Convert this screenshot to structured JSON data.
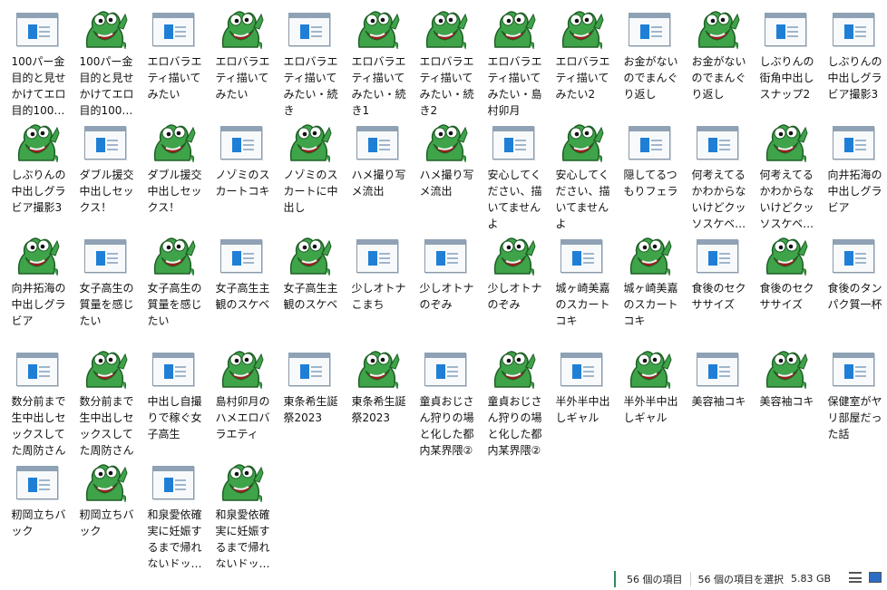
{
  "items": [
    {
      "name": "100パー金目的と見せかけてエロ目的100…",
      "icon": "window-icon"
    },
    {
      "name": "100パー金目的と見せかけてエロ目的100…",
      "icon": "frog-icon"
    },
    {
      "name": "エロバラエティ描いてみたい",
      "icon": "window-icon"
    },
    {
      "name": "エロバラエティ描いてみたい",
      "icon": "frog-icon"
    },
    {
      "name": "エロバラエティ描いてみたい・続き",
      "icon": "window-icon"
    },
    {
      "name": "エロバラエティ描いてみたい・続き1",
      "icon": "frog-icon"
    },
    {
      "name": "エロバラエティ描いてみたい・続き2",
      "icon": "frog-icon"
    },
    {
      "name": "エロバラエティ描いてみたい・島村卯月",
      "icon": "frog-icon"
    },
    {
      "name": "エロバラエティ描いてみたい2",
      "icon": "frog-icon"
    },
    {
      "name": "お金がないのでまんぐり返し",
      "icon": "window-icon"
    },
    {
      "name": "お金がないのでまんぐり返し",
      "icon": "frog-icon"
    },
    {
      "name": "しぶりんの街角中出しスナップ2",
      "icon": "window-icon"
    },
    {
      "name": "しぶりんの中出しグラビア撮影3",
      "icon": "window-icon"
    },
    {
      "name": "しぶりんの中出しグラビア撮影3",
      "icon": "frog-icon"
    },
    {
      "name": "ダブル援交中出しセックス！",
      "icon": "window-icon"
    },
    {
      "name": "ダブル援交中出しセックス！",
      "icon": "frog-icon"
    },
    {
      "name": "ノゾミのスカートコキ",
      "icon": "window-icon"
    },
    {
      "name": "ノゾミのスカートに中出し",
      "icon": "frog-icon"
    },
    {
      "name": "ハメ撮り写メ流出",
      "icon": "window-icon"
    },
    {
      "name": "ハメ撮り写メ流出",
      "icon": "frog-icon"
    },
    {
      "name": "安心してください、描いてませんよ",
      "icon": "window-icon"
    },
    {
      "name": "安心してください、描いてませんよ",
      "icon": "frog-icon"
    },
    {
      "name": "隠してるつもりフェラ",
      "icon": "window-icon"
    },
    {
      "name": "何考えてるかわからないけどクッソスケベ…",
      "icon": "window-icon"
    },
    {
      "name": "何考えてるかわからないけどクッソスケベ…",
      "icon": "frog-icon"
    },
    {
      "name": "向井拓海の中出しグラビア",
      "icon": "window-icon"
    },
    {
      "name": "向井拓海の中出しグラビア",
      "icon": "frog-icon"
    },
    {
      "name": "女子高生の質量を感じたい",
      "icon": "window-icon"
    },
    {
      "name": "女子高生の質量を感じたい",
      "icon": "frog-icon"
    },
    {
      "name": "女子高生主観のスケベ",
      "icon": "window-icon"
    },
    {
      "name": "女子高生主観のスケベ",
      "icon": "frog-icon"
    },
    {
      "name": "少しオトナこまち",
      "icon": "window-icon"
    },
    {
      "name": "少しオトナのぞみ",
      "icon": "window-icon"
    },
    {
      "name": "少しオトナのぞみ",
      "icon": "frog-icon"
    },
    {
      "name": "城ヶ崎美嘉のスカートコキ",
      "icon": "window-icon"
    },
    {
      "name": "城ヶ崎美嘉のスカートコキ",
      "icon": "frog-icon"
    },
    {
      "name": "食後のセクササイズ",
      "icon": "window-icon"
    },
    {
      "name": "食後のセクササイズ",
      "icon": "frog-icon"
    },
    {
      "name": "食後のタンパク質一杯",
      "icon": "window-icon"
    },
    {
      "name": "数分前まで生中出しセックスしてた周防さん",
      "icon": "window-icon"
    },
    {
      "name": "数分前まで生中出しセックスしてた周防さん",
      "icon": "frog-icon"
    },
    {
      "name": "中出し自撮りで稼ぐ女子高生",
      "icon": "window-icon"
    },
    {
      "name": "島村卯月のハメエロバラエティ",
      "icon": "frog-icon"
    },
    {
      "name": "東条希生誕祭2023",
      "icon": "window-icon"
    },
    {
      "name": "東条希生誕祭2023",
      "icon": "frog-icon"
    },
    {
      "name": "童貞おじさん狩りの場と化した都内某界隈②",
      "icon": "window-icon"
    },
    {
      "name": "童貞おじさん狩りの場と化した都内某界隈②",
      "icon": "frog-icon"
    },
    {
      "name": "半外半中出しギャル",
      "icon": "window-icon"
    },
    {
      "name": "半外半中出しギャル",
      "icon": "frog-icon"
    },
    {
      "name": "美容袖コキ",
      "icon": "window-icon"
    },
    {
      "name": "美容袖コキ",
      "icon": "frog-icon"
    },
    {
      "name": "保健室がヤリ部屋だった話",
      "icon": "window-icon"
    },
    {
      "name": "籾岡立ちバック",
      "icon": "window-icon"
    },
    {
      "name": "籾岡立ちバック",
      "icon": "frog-icon"
    },
    {
      "name": "和泉愛依確実に妊娠するまで帰れないドッ…",
      "icon": "window-icon"
    },
    {
      "name": "和泉愛依確実に妊娠するまで帰れないドッ…",
      "icon": "frog-icon"
    }
  ],
  "status": {
    "item_count": "56 個の項目",
    "selection": "56 個の項目を選択",
    "size": "5.83 GB"
  },
  "colors": {
    "accent_green": "#2e8b57",
    "frog_green": "#3fa34a",
    "window_blue": "#1f7fd6"
  }
}
